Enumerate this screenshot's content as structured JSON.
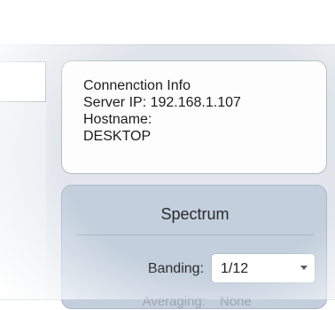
{
  "connection_info": {
    "title": "Connenction Info",
    "server_ip": "Server IP: 192.168.1.107",
    "hostname_label": "Hostname:",
    "hostname_value": "DESKTOP"
  },
  "spectrum": {
    "title": "Spectrum",
    "banding_label": "Banding:",
    "banding_value": "1/12",
    "averaging_label": "Averaging:",
    "averaging_value": "None"
  }
}
